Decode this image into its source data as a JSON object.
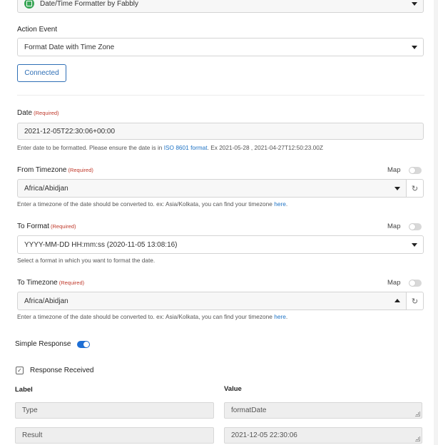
{
  "app_select": {
    "value": "Date/Time Formatter by Fabbly",
    "icon": "spreadsheet-app-icon"
  },
  "action_event": {
    "label": "Action Event",
    "value": "Format Date with Time Zone"
  },
  "connection": {
    "label": "Connected"
  },
  "date_field": {
    "label": "Date",
    "required": "(Required)",
    "value": "2021-12-05T22:30:06+00:00",
    "help_prefix": "Enter date to be formatted. Please ensure the date is in ",
    "help_link": "ISO 8601 format",
    "help_suffix": ". Ex 2021-05-28 , 2021-04-27T12:50:23.00Z"
  },
  "from_timezone": {
    "label": "From Timezone",
    "required": "(Required)",
    "map_label": "Map",
    "value": "Africa/Abidjan",
    "help_prefix": "Enter a timezone of the date should be converted to. ex: Asia/Kolkata, you can find your timezone ",
    "help_link": "here",
    "help_suffix": "."
  },
  "to_format": {
    "label": "To Format",
    "required": "(Required)",
    "map_label": "Map",
    "value": "YYYY-MM-DD HH:mm:ss (2020-11-05 13:08:16)",
    "help": "Select a format in which you want to format the date."
  },
  "to_timezone": {
    "label": "To Timezone",
    "required": "(Required)",
    "map_label": "Map",
    "value": "Africa/Abidjan",
    "help_prefix": "Enter a timezone of the date should be converted to. ex: Asia/Kolkata, you can find your timezone ",
    "help_link": "here",
    "help_suffix": "."
  },
  "simple_response": {
    "label": "Simple Response",
    "enabled": true
  },
  "response_received": {
    "label": "Response Received",
    "checked": true
  },
  "response_table": {
    "label_header": "Label",
    "value_header": "Value",
    "rows": [
      {
        "label": "Type",
        "value": "formatDate"
      },
      {
        "label": "Result",
        "value": "2021-12-05 22:30:06"
      }
    ]
  },
  "colors": {
    "accent": "#1d6fd6",
    "required": "#c0392b",
    "link": "#1d72c4",
    "app_icon": "#3aa657"
  }
}
